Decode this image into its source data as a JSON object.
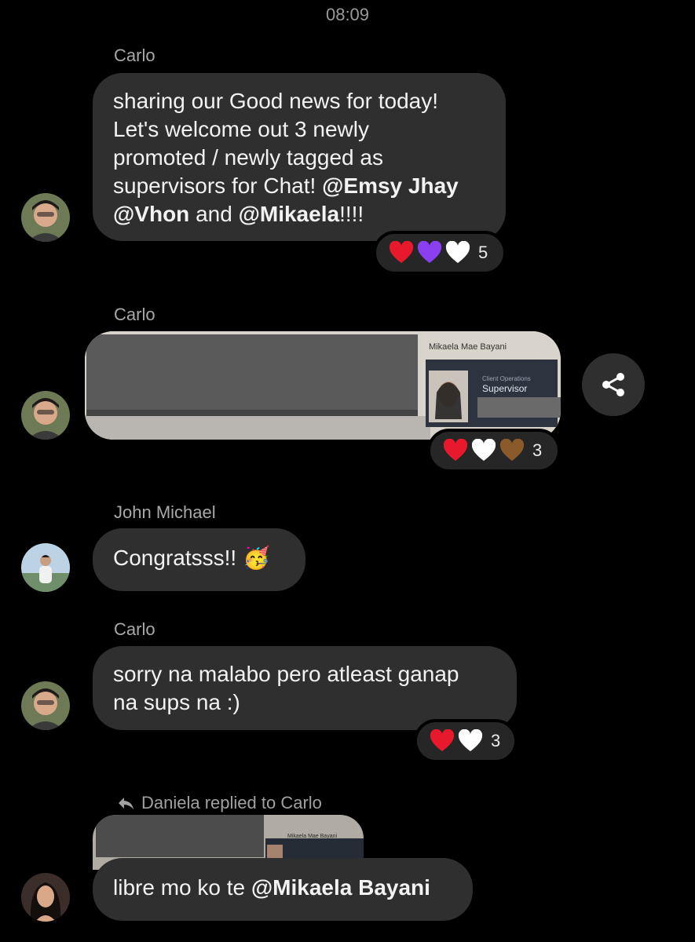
{
  "time": "08:09",
  "messages": [
    {
      "sender": "Carlo",
      "text_a": "sharing our Good news for today!",
      "text_b": "Let's welcome out 3 newly",
      "text_c": "promoted / newly tagged as",
      "text_d": "supervisors for Chat! ",
      "mention_1": "@Emsy Jhay",
      "mention_2": "@Vhon",
      "text_e": " and ",
      "mention_3": "@Mikaela",
      "text_f": "!!!!",
      "reaction_count": "5"
    },
    {
      "sender": "Carlo",
      "photo_name": "Mikaela Mae Bayani",
      "photo_dept": "Client Operations",
      "photo_role": "Supervisor",
      "reaction_count": "3"
    },
    {
      "sender": "John Michael",
      "text": "Congratsss!! 🥳"
    },
    {
      "sender": "Carlo",
      "text_a": "sorry na malabo pero atleast ganap",
      "text_b": "na sups na :)",
      "reaction_count": "3"
    },
    {
      "reply_label": "Daniela replied to Carlo",
      "quoted_photo_name": "Mikaela Mae Bayani",
      "text": "libre mo ko te ",
      "mention": "@Mikaela Bayani"
    }
  ],
  "colors": {
    "background": "#000000",
    "bubble": "#2f2f2f",
    "red_heart": "#e8192c",
    "purple_heart": "#8a3ff0",
    "white_heart": "#ffffff",
    "brown_heart": "#8a5a2b"
  },
  "icons": [
    "share-icon",
    "reply-arrow-icon"
  ]
}
